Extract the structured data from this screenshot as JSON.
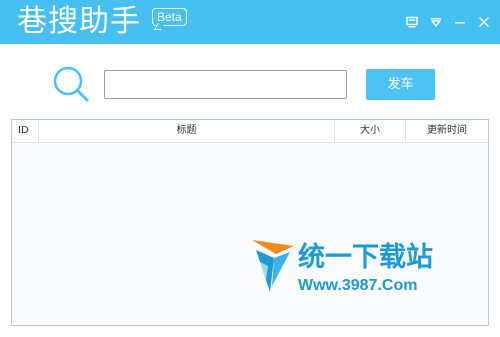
{
  "app": {
    "title": "巷搜助手",
    "badge": "Beta",
    "accent_color": "#46c0f2"
  },
  "window_controls": [
    {
      "icon": "skin-icon"
    },
    {
      "icon": "menu-dropdown-icon"
    },
    {
      "icon": "minimize-icon"
    },
    {
      "icon": "close-icon"
    }
  ],
  "search": {
    "icon": "search-icon",
    "value": "",
    "placeholder": "",
    "button_label": "发车"
  },
  "table": {
    "columns": [
      "ID",
      "标题",
      "大小",
      "更新时间"
    ],
    "rows": []
  },
  "watermark": {
    "brand": "统一下载站",
    "url": "Www.3987.Com"
  }
}
